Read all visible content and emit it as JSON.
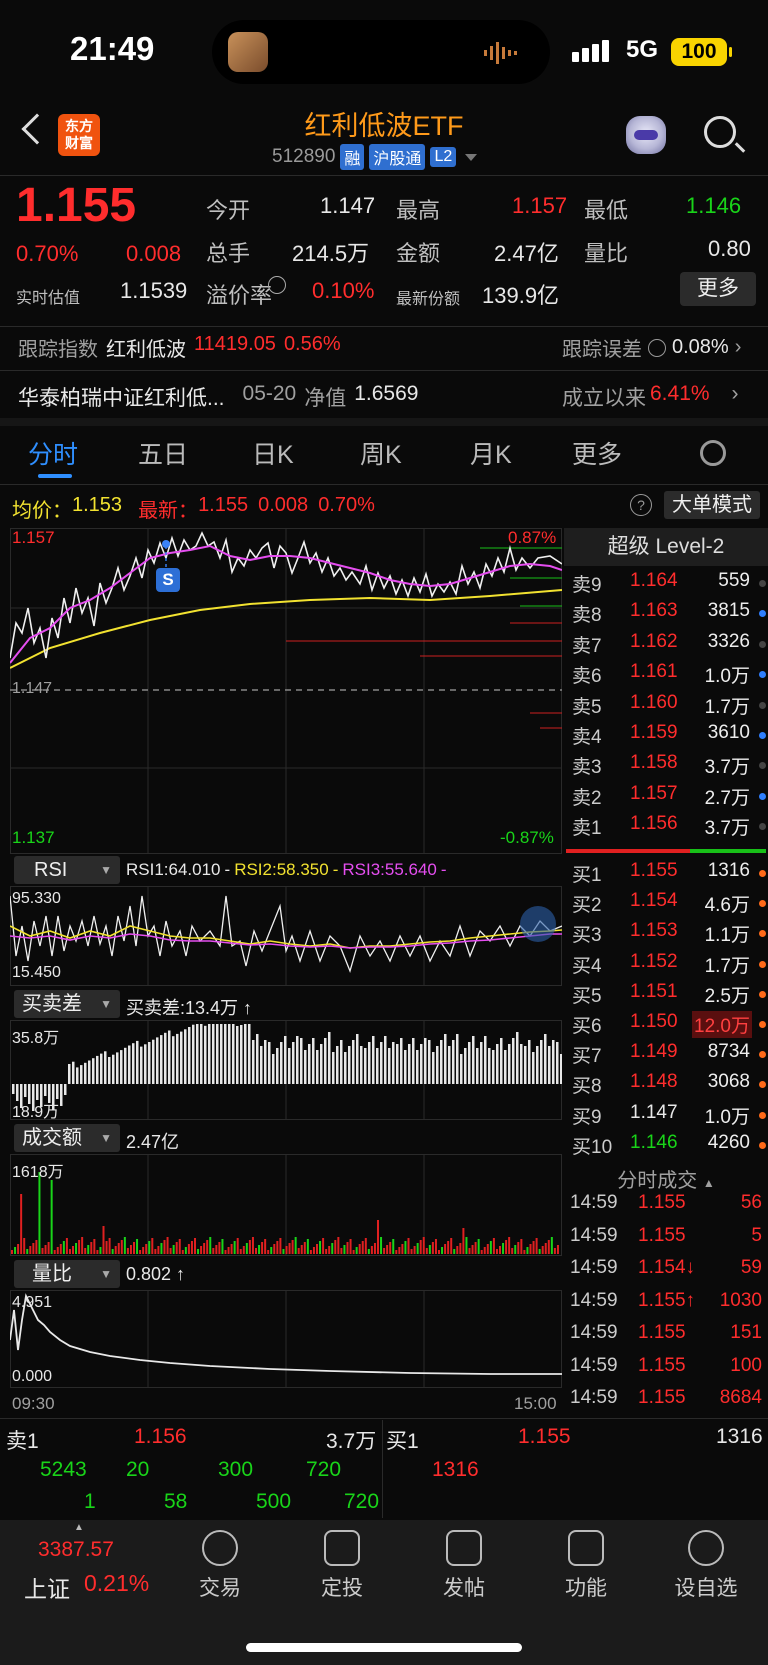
{
  "status": {
    "time": "21:49",
    "network": "5G",
    "battery": "100"
  },
  "header": {
    "title": "红利低波ETF",
    "code": "512890",
    "tags": [
      "融",
      "沪股通",
      "L2"
    ],
    "logo": "东方财富"
  },
  "quote": {
    "price": "1.155",
    "pct": "0.70%",
    "change": "0.008",
    "open_label": "今开",
    "open": "1.147",
    "high_label": "最高",
    "high": "1.157",
    "low_label": "最低",
    "low": "1.146",
    "vol_label": "总手",
    "vol": "214.5万",
    "amt_label": "金额",
    "amt": "2.47亿",
    "ratio_label": "量比",
    "ratio": "0.80",
    "est_label": "实时估值",
    "est": "1.1539",
    "prem_label": "溢价率",
    "prem": "0.10%",
    "share_label": "最新份额",
    "share": "139.9亿",
    "more": "更多"
  },
  "track": {
    "label": "跟踪指数",
    "name": "红利低波",
    "value": "11419.05",
    "pct": "0.56%",
    "err_label": "跟踪误差",
    "err": "0.08%"
  },
  "fund": {
    "name": "华泰柏瑞中证红利低...",
    "nav_date": "05-20",
    "nav_label": "净值",
    "nav": "1.6569",
    "since_label": "成立以来",
    "since": "6.41%"
  },
  "tabs": [
    "分时",
    "五日",
    "日K",
    "周K",
    "月K",
    "更多"
  ],
  "chart": {
    "avg_label": "均价：",
    "avg": "1.153",
    "last_label": "最新：",
    "last": "1.155",
    "chg": "0.008",
    "pct": "0.70%",
    "mode_btn": "大单模式",
    "ymax": "1.157",
    "ymin": "1.137",
    "pmax": "0.87%",
    "pmin": "-0.87%",
    "base": "1.147",
    "marker": "S",
    "rsi_btn": "RSI",
    "rsi1": "RSI1:64.010",
    "rsi2": "RSI2:58.350",
    "rsi3": "RSI3:55.640",
    "rsi_max": "95.330",
    "rsi_min": "15.450",
    "diff_btn": "买卖差",
    "diff": "买卖差:13.4万 ↑",
    "diff_max": "35.8万",
    "diff_min": "18.9万",
    "amt_btn": "成交额",
    "amt": "2.47亿",
    "amt_max": "1618万",
    "lb_btn": "量比",
    "lb": "0.802 ↑",
    "lb_max": "4.951",
    "lb_min": "0.000",
    "t_start": "09:30",
    "t_end": "15:00"
  },
  "level2": {
    "title": "超级 Level-2",
    "asks": [
      {
        "l": "卖9",
        "p": "1.164",
        "v": "559"
      },
      {
        "l": "卖8",
        "p": "1.163",
        "v": "3815"
      },
      {
        "l": "卖7",
        "p": "1.162",
        "v": "3326"
      },
      {
        "l": "卖6",
        "p": "1.161",
        "v": "1.0万"
      },
      {
        "l": "卖5",
        "p": "1.160",
        "v": "1.7万"
      },
      {
        "l": "卖4",
        "p": "1.159",
        "v": "3610"
      },
      {
        "l": "卖3",
        "p": "1.158",
        "v": "3.7万"
      },
      {
        "l": "卖2",
        "p": "1.157",
        "v": "2.7万"
      },
      {
        "l": "卖1",
        "p": "1.156",
        "v": "3.7万"
      }
    ],
    "bids": [
      {
        "l": "买1",
        "p": "1.155",
        "v": "1316"
      },
      {
        "l": "买2",
        "p": "1.154",
        "v": "4.6万"
      },
      {
        "l": "买3",
        "p": "1.153",
        "v": "1.1万"
      },
      {
        "l": "买4",
        "p": "1.152",
        "v": "1.7万"
      },
      {
        "l": "买5",
        "p": "1.151",
        "v": "2.5万"
      },
      {
        "l": "买6",
        "p": "1.150",
        "v": "12.0万"
      },
      {
        "l": "买7",
        "p": "1.149",
        "v": "8734"
      },
      {
        "l": "买8",
        "p": "1.148",
        "v": "3068"
      },
      {
        "l": "买9",
        "p": "1.147",
        "v": "1.0万"
      },
      {
        "l": "买10",
        "p": "1.146",
        "v": "4260"
      }
    ]
  },
  "ticks": {
    "title": "分时成交",
    "rows": [
      {
        "t": "14:59",
        "p": "1.155",
        "v": "56"
      },
      {
        "t": "14:59",
        "p": "1.155",
        "v": "5"
      },
      {
        "t": "14:59",
        "p": "1.154↓",
        "v": "59"
      },
      {
        "t": "14:59",
        "p": "1.155↑",
        "v": "1030"
      },
      {
        "t": "14:59",
        "p": "1.155",
        "v": "151"
      },
      {
        "t": "14:59",
        "p": "1.155",
        "v": "100"
      },
      {
        "t": "14:59",
        "p": "1.155",
        "v": "8684"
      }
    ]
  },
  "bottom_orders": {
    "sell_label": "卖1",
    "sell_price": "1.156",
    "sell_vol": "3.7万",
    "buy_label": "买1",
    "buy_price": "1.155",
    "buy_vol": "1316",
    "sell_row1": [
      "5243",
      "20",
      "300",
      "720"
    ],
    "sell_row2": [
      "1",
      "58",
      "500",
      "720"
    ],
    "buy_row1": "1316"
  },
  "index": {
    "value": "3387.57",
    "name": "上证",
    "pct": "0.21%"
  },
  "nav": [
    "交易",
    "定投",
    "发帖",
    "功能",
    "设自选"
  ]
}
